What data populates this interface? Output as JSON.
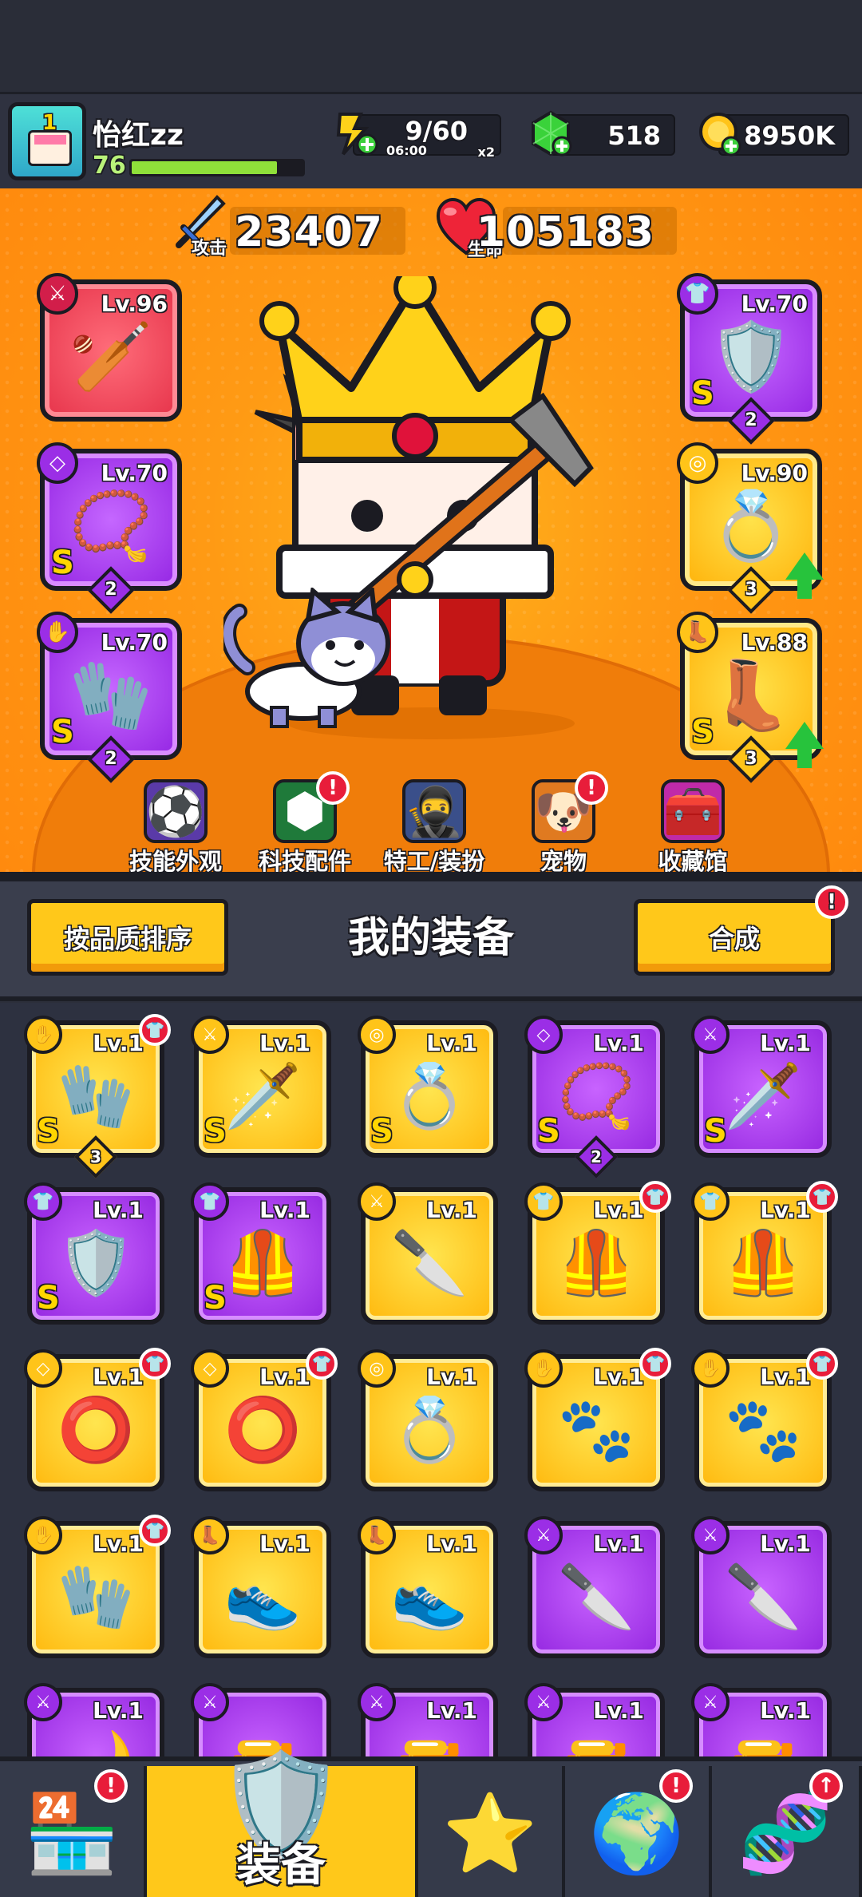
{
  "player": {
    "name": "怡红zz",
    "level": "76",
    "xp_fraction": 0.85
  },
  "resources": {
    "energy": {
      "value": "9/60",
      "timer": "06:00",
      "multiplier": "x2",
      "icon": "energy-icon"
    },
    "gems": {
      "value": "518",
      "icon": "gem-icon"
    },
    "coins": {
      "value": "8950K",
      "icon": "coin-icon"
    }
  },
  "stats": {
    "attack": {
      "label": "攻击",
      "value": "23407",
      "icon": "sword-icon"
    },
    "hp": {
      "label": "生命",
      "value": "105183",
      "icon": "heart-icon"
    }
  },
  "equipped_left": [
    {
      "slot": "weapon",
      "lv": "Lv.96",
      "rarity": "red",
      "item": "🏏",
      "grade": "",
      "stars": ""
    },
    {
      "slot": "necklace",
      "lv": "Lv.70",
      "rarity": "purple",
      "item": "📿",
      "grade": "S",
      "stars": "2"
    },
    {
      "slot": "gloves",
      "lv": "Lv.70",
      "rarity": "purple",
      "item": "🧤",
      "grade": "S",
      "stars": "2"
    }
  ],
  "equipped_right": [
    {
      "slot": "armor",
      "lv": "Lv.70",
      "rarity": "purple",
      "item": "🛡️",
      "grade": "S",
      "stars": "2",
      "upgrade": false
    },
    {
      "slot": "belt",
      "lv": "Lv.90",
      "rarity": "gold",
      "item": "💍",
      "grade": "",
      "stars": "3",
      "upgrade": true
    },
    {
      "slot": "boots",
      "lv": "Lv.88",
      "rarity": "gold",
      "item": "👢",
      "grade": "S",
      "stars": "3",
      "upgrade": true
    }
  ],
  "menu": [
    {
      "label": "技能外观",
      "icon": "skill-skin-icon",
      "glyph": "⚽",
      "badge": false
    },
    {
      "label": "科技配件",
      "icon": "tech-parts-icon",
      "glyph": "⬢",
      "badge": true
    },
    {
      "label": "特工/装扮",
      "icon": "agent-costume-icon",
      "glyph": "🥷",
      "badge": false
    },
    {
      "label": "宠物",
      "icon": "pet-icon",
      "glyph": "🐶",
      "badge": true
    },
    {
      "label": "收藏馆",
      "icon": "collection-icon",
      "glyph": "🧰",
      "badge": false
    }
  ],
  "controls": {
    "sort_label": "按品质排序",
    "title": "我的装备",
    "merge_label": "合成",
    "merge_badge": "!"
  },
  "inventory": [
    {
      "lv": "Lv.1",
      "rarity": "gold",
      "item": "🧤",
      "grade": "S",
      "stars": "3",
      "notice": true
    },
    {
      "lv": "Lv.1",
      "rarity": "gold",
      "item": "🗡️",
      "grade": "S",
      "stars": "",
      "notice": false
    },
    {
      "lv": "Lv.1",
      "rarity": "gold",
      "item": "💍",
      "grade": "S",
      "stars": "",
      "notice": false
    },
    {
      "lv": "Lv.1",
      "rarity": "purple",
      "item": "📿",
      "grade": "S",
      "stars": "2",
      "notice": false
    },
    {
      "lv": "Lv.1",
      "rarity": "purple",
      "item": "🗡️",
      "grade": "S",
      "stars": "",
      "notice": false
    },
    {
      "lv": "Lv.1",
      "rarity": "purple",
      "item": "🛡️",
      "grade": "S",
      "stars": "",
      "notice": false
    },
    {
      "lv": "Lv.1",
      "rarity": "purple",
      "item": "🦺",
      "grade": "S",
      "stars": "",
      "notice": false
    },
    {
      "lv": "Lv.1",
      "rarity": "gold",
      "item": "🔪",
      "grade": "",
      "stars": "",
      "notice": false
    },
    {
      "lv": "Lv.1",
      "rarity": "gold",
      "item": "🦺",
      "grade": "",
      "stars": "",
      "notice": true
    },
    {
      "lv": "Lv.1",
      "rarity": "gold",
      "item": "🦺",
      "grade": "",
      "stars": "",
      "notice": true
    },
    {
      "lv": "Lv.1",
      "rarity": "gold",
      "item": "⭕",
      "grade": "",
      "stars": "",
      "notice": true
    },
    {
      "lv": "Lv.1",
      "rarity": "gold",
      "item": "⭕",
      "grade": "",
      "stars": "",
      "notice": true
    },
    {
      "lv": "Lv.1",
      "rarity": "gold",
      "item": "💍",
      "grade": "",
      "stars": "",
      "notice": false
    },
    {
      "lv": "Lv.1",
      "rarity": "gold",
      "item": "🐾",
      "grade": "",
      "stars": "",
      "notice": true
    },
    {
      "lv": "Lv.1",
      "rarity": "gold",
      "item": "🐾",
      "grade": "",
      "stars": "",
      "notice": true
    },
    {
      "lv": "Lv.1",
      "rarity": "gold",
      "item": "🧤",
      "grade": "",
      "stars": "",
      "notice": true
    },
    {
      "lv": "Lv.1",
      "rarity": "gold",
      "item": "👟",
      "grade": "",
      "stars": "",
      "notice": false
    },
    {
      "lv": "Lv.1",
      "rarity": "gold",
      "item": "👟",
      "grade": "",
      "stars": "",
      "notice": false
    },
    {
      "lv": "Lv.1",
      "rarity": "purple",
      "item": "🔪",
      "grade": "",
      "stars": "",
      "notice": false
    },
    {
      "lv": "Lv.1",
      "rarity": "purple",
      "item": "🔪",
      "grade": "",
      "stars": "",
      "notice": false
    },
    {
      "lv": "Lv.1",
      "rarity": "purple",
      "item": "🌙",
      "grade": "",
      "stars": "",
      "notice": false
    },
    {
      "lv": "",
      "rarity": "purple",
      "item": "🔫",
      "grade": "",
      "stars": "",
      "notice": false
    },
    {
      "lv": "Lv.1",
      "rarity": "purple",
      "item": "🔫",
      "grade": "",
      "stars": "",
      "notice": false
    },
    {
      "lv": "Lv.1",
      "rarity": "purple",
      "item": "🔫",
      "grade": "",
      "stars": "",
      "notice": false
    },
    {
      "lv": "Lv.1",
      "rarity": "purple",
      "item": "🔫",
      "grade": "",
      "stars": "",
      "notice": false
    }
  ],
  "nav": [
    {
      "name": "shop",
      "label": "",
      "glyph": "🏪",
      "badge": "!",
      "active": false
    },
    {
      "name": "equipment",
      "label": "装备",
      "glyph": "🛡️",
      "badge": "",
      "active": true
    },
    {
      "name": "talent",
      "label": "",
      "glyph": "⭐",
      "badge": "",
      "active": false
    },
    {
      "name": "world",
      "label": "",
      "glyph": "🌍",
      "badge": "!",
      "active": false
    },
    {
      "name": "evolve",
      "label": "",
      "glyph": "🧬",
      "badge": "↑",
      "active": false
    }
  ],
  "colors": {
    "accent": "#ffc81a",
    "gold": "#ffb80d",
    "purple": "#9427e0",
    "red": "#e6334a",
    "bg": "#2d3140"
  }
}
